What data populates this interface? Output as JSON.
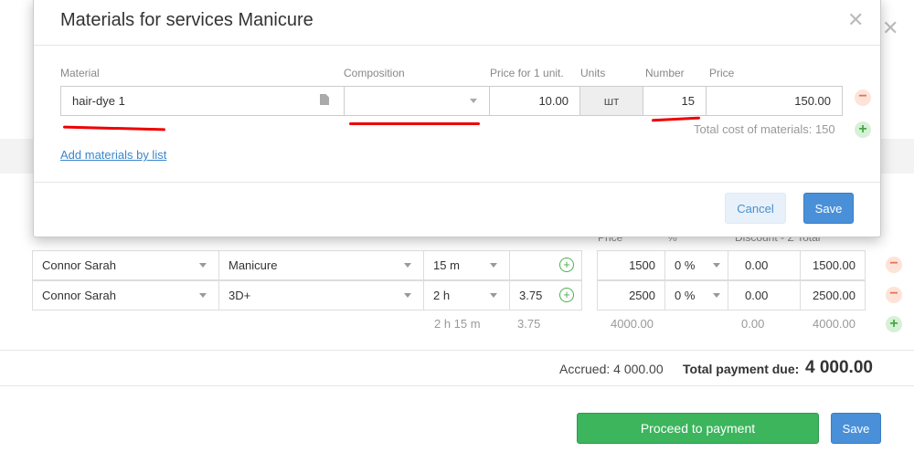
{
  "modal": {
    "title": "Materials for services Manicure",
    "columns": {
      "material": "Material",
      "composition": "Composition",
      "price_unit": "Price for 1 unit.",
      "units": "Units",
      "number": "Number",
      "price": "Price"
    },
    "row": {
      "material": "hair-dye 1",
      "composition": "",
      "price_unit": "10.00",
      "units": "шт",
      "number": "15",
      "price": "150.00"
    },
    "total_cost": "Total cost of materials: 150",
    "add_link": "Add materials by list",
    "cancel": "Cancel",
    "save": "Save"
  },
  "background": {
    "headers": {
      "price": "Price",
      "percent": "%",
      "discount_total": "Discount - Σ Total"
    },
    "rows": [
      {
        "employee": "Connor Sarah",
        "service": "Manicure",
        "duration": "15 m",
        "extra": "",
        "price": "1500",
        "percent": "0 %",
        "discount": "0.00",
        "total": "1500.00"
      },
      {
        "employee": "Connor Sarah",
        "service": "3D+",
        "duration": "2 h",
        "extra": "3.75",
        "price": "2500",
        "percent": "0 %",
        "discount": "0.00",
        "total": "2500.00"
      }
    ],
    "summary": {
      "duration": "2 h 15 m",
      "extra": "3.75",
      "price": "4000.00",
      "discount": "0.00",
      "total": "4000.00"
    },
    "accrued": "Accrued: 4 000.00",
    "total_label": "Total payment due:",
    "total_value": "4 000.00",
    "proceed": "Proceed to payment",
    "save": "Save"
  },
  "icons": {
    "close": "close-icon",
    "document": "document-icon",
    "caret": "chevron-down-icon",
    "add": "plus-icon",
    "remove": "minus-icon"
  },
  "colors": {
    "primary": "#4a90d9",
    "success": "#3cb55d",
    "danger_light": "#fde3d8",
    "annotation": "#e00000"
  }
}
